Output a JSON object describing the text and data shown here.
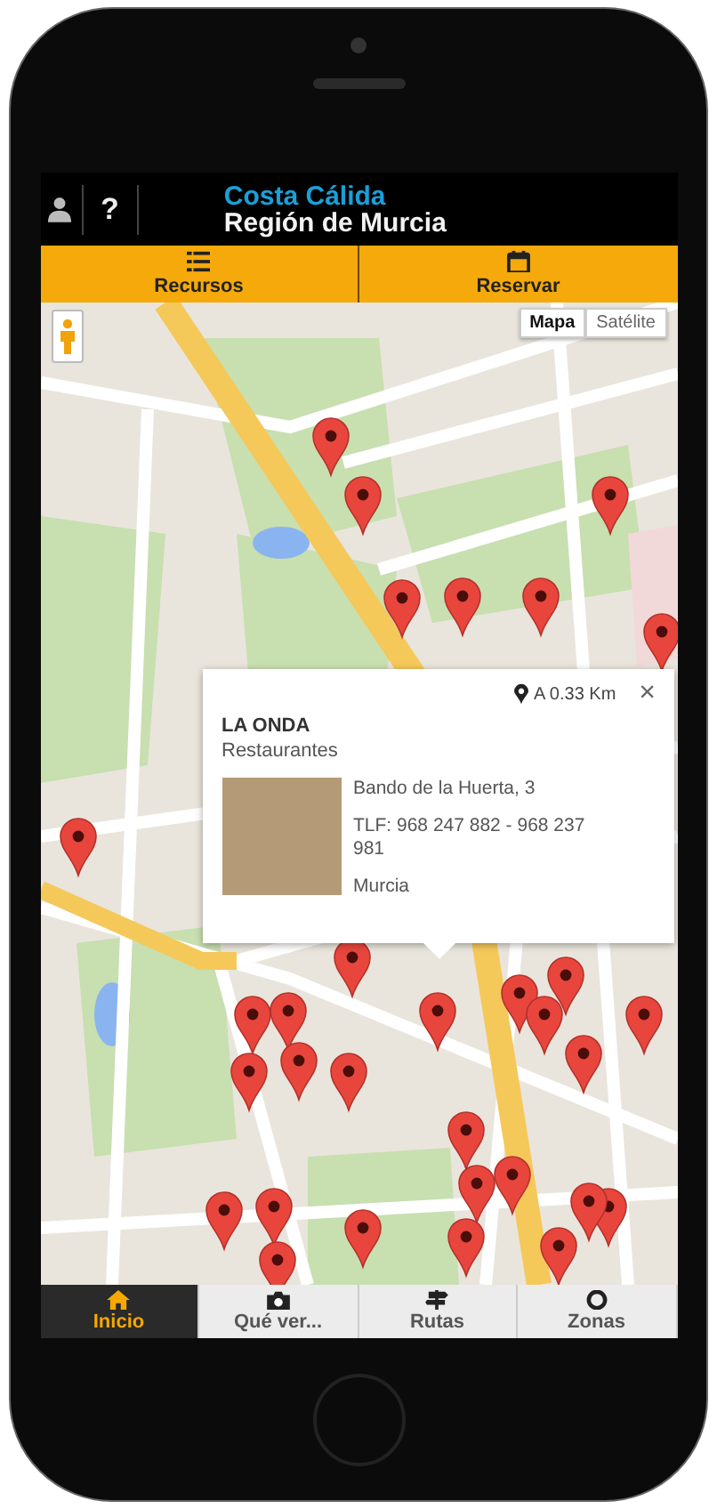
{
  "header": {
    "help": "?",
    "brand_line_1": "Costa Cálida",
    "brand_line_2": "Región de Murcia"
  },
  "top_tabs": [
    {
      "label": "Recursos"
    },
    {
      "label": "Reservar"
    }
  ],
  "map_type": [
    {
      "label": "Mapa",
      "selected": true
    },
    {
      "label": "Satélite",
      "selected": false
    }
  ],
  "popup": {
    "distance": "A 0.33 Km",
    "close": "×",
    "name": "LA ONDA",
    "category": "Restaurantes",
    "address": "Bando de la Huerta, 3",
    "phone": "TLF: 968 247 882 - 968 237 981",
    "city": "Murcia"
  },
  "bottom_tabs": [
    {
      "label": "Inicio",
      "selected": true
    },
    {
      "label": "Qué ver...",
      "selected": false
    },
    {
      "label": "Rutas",
      "selected": false
    },
    {
      "label": "Zonas",
      "selected": false
    }
  ]
}
